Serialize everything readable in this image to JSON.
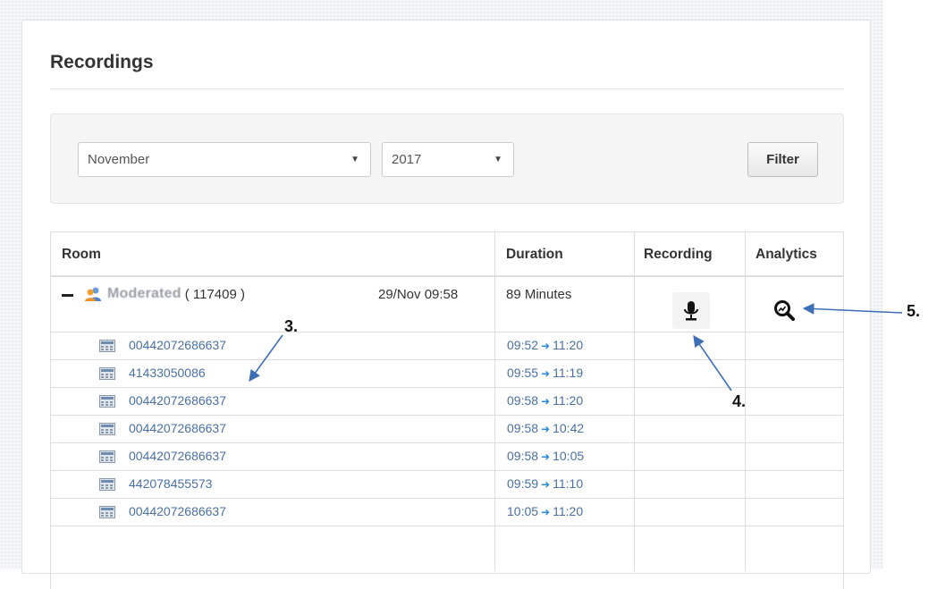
{
  "page": {
    "title": "Recordings"
  },
  "filter": {
    "month": {
      "selected": "November"
    },
    "year": {
      "selected": "2017"
    },
    "button_label": "Filter"
  },
  "table": {
    "headers": {
      "room": "Room",
      "duration": "Duration",
      "recording": "Recording",
      "analytics": "Analytics"
    },
    "room_row": {
      "name": "Moderated",
      "id": "( 117409 )",
      "date": "29/Nov 09:58",
      "duration": "89 Minutes",
      "recording_icon": "microphone-icon",
      "analytics_icon": "analytics-search-icon"
    },
    "calls": [
      {
        "number": "00442072686637",
        "start": "09:52",
        "end": "11:20"
      },
      {
        "number": "41433050086",
        "start": "09:55",
        "end": "11:19"
      },
      {
        "number": "00442072686637",
        "start": "09:58",
        "end": "11:20"
      },
      {
        "number": "00442072686637",
        "start": "09:58",
        "end": "10:42"
      },
      {
        "number": "00442072686637",
        "start": "09:58",
        "end": "10:05"
      },
      {
        "number": "442078455573",
        "start": "09:59",
        "end": "11:10"
      },
      {
        "number": "00442072686637",
        "start": "10:05",
        "end": "11:20"
      }
    ]
  },
  "annotations": {
    "n3": "3.",
    "n4": "4.",
    "n5": "5."
  },
  "colors": {
    "link": "#4a6fa5",
    "arrow": "#2b8ad8",
    "callout": "#3d6fb6"
  }
}
